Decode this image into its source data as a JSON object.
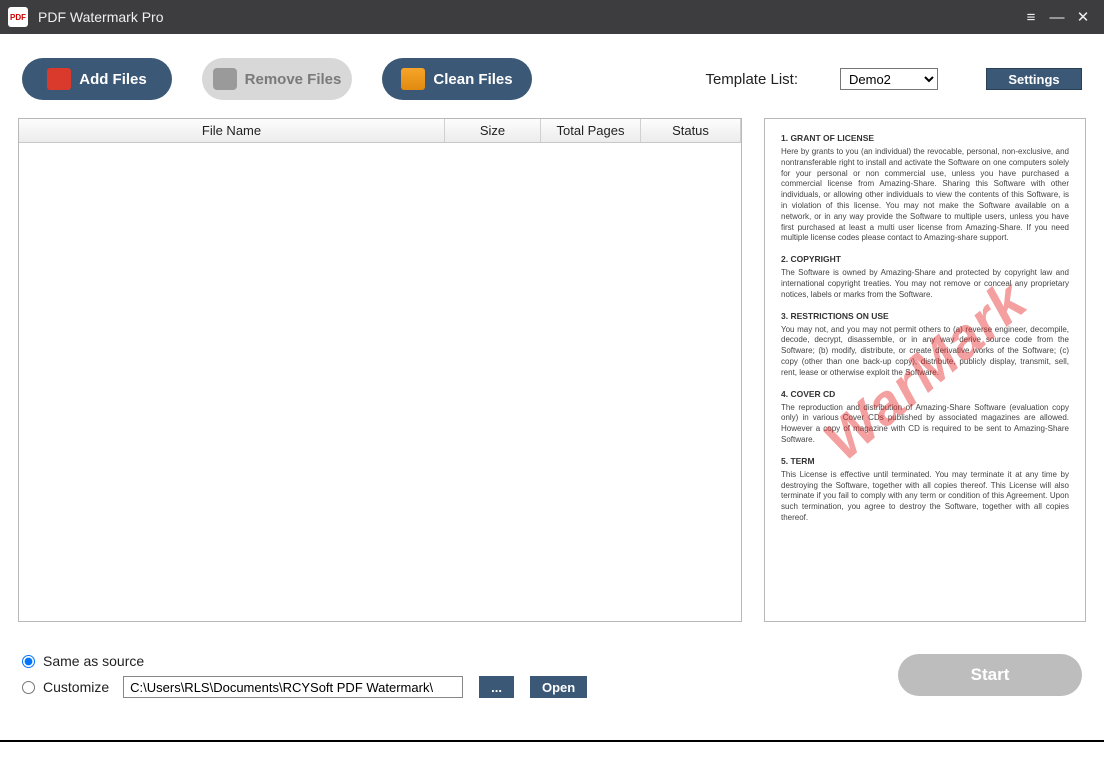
{
  "titlebar": {
    "title": "PDF Watermark Pro"
  },
  "toolbar": {
    "add_files": "Add Files",
    "remove_files": "Remove Files",
    "clean_files": "Clean Files",
    "template_label": "Template List:",
    "template_selected": "Demo2",
    "settings": "Settings"
  },
  "table": {
    "headers": {
      "name": "File Name",
      "size": "Size",
      "pages": "Total Pages",
      "status": "Status"
    },
    "rows": []
  },
  "preview": {
    "watermark_text": "WarMark",
    "sections": [
      {
        "heading": "1. GRANT OF LICENSE",
        "body": "Here by grants to you (an individual) the revocable, personal, non-exclusive, and nontransferable right to install and activate the Software on one computers solely for your personal or non commercial use, unless you have purchased a commercial license from Amazing-Share. Sharing this Software with other individuals, or allowing other individuals to view the contents of this Software, is in violation of this license. You may not make the Software available on a network, or in any way provide the Software to multiple users, unless you have first purchased at least a multi user license from Amazing-Share. If you need multiple license codes please contact to Amazing-share support."
      },
      {
        "heading": "2. COPYRIGHT",
        "body": "The Software is owned by Amazing-Share and protected by copyright law and international copyright treaties. You may not remove or conceal any proprietary notices, labels or marks from the Software."
      },
      {
        "heading": "3. RESTRICTIONS ON USE",
        "body": "You may not, and you may not permit others to (a) reverse engineer, decompile, decode, decrypt, disassemble, or in any way derive source code from the Software; (b) modify, distribute, or create derivative works of the Software; (c) copy (other than one back-up copy), distribute, publicly display, transmit, sell, rent, lease or otherwise exploit the Software."
      },
      {
        "heading": "4. COVER CD",
        "body": "The reproduction and distribution of Amazing-Share Software (evaluation copy only) in various Cover CDs published by associated magazines are allowed. However a copy of magazine with CD is required to be sent to Amazing-Share Software."
      },
      {
        "heading": "5. TERM",
        "body": "This License is effective until terminated. You may terminate it at any time by destroying the Software, together with all copies thereof. This License will also terminate if you fail to comply with any term or condition of this Agreement. Upon such termination, you agree to destroy the Software, together with all copies thereof."
      }
    ]
  },
  "output": {
    "same_as_source": "Same as source",
    "customize": "Customize",
    "path": "C:\\Users\\RLS\\Documents\\RCYSoft PDF Watermark\\",
    "browse": "...",
    "open": "Open",
    "selected": "same"
  },
  "start": {
    "label": "Start"
  }
}
